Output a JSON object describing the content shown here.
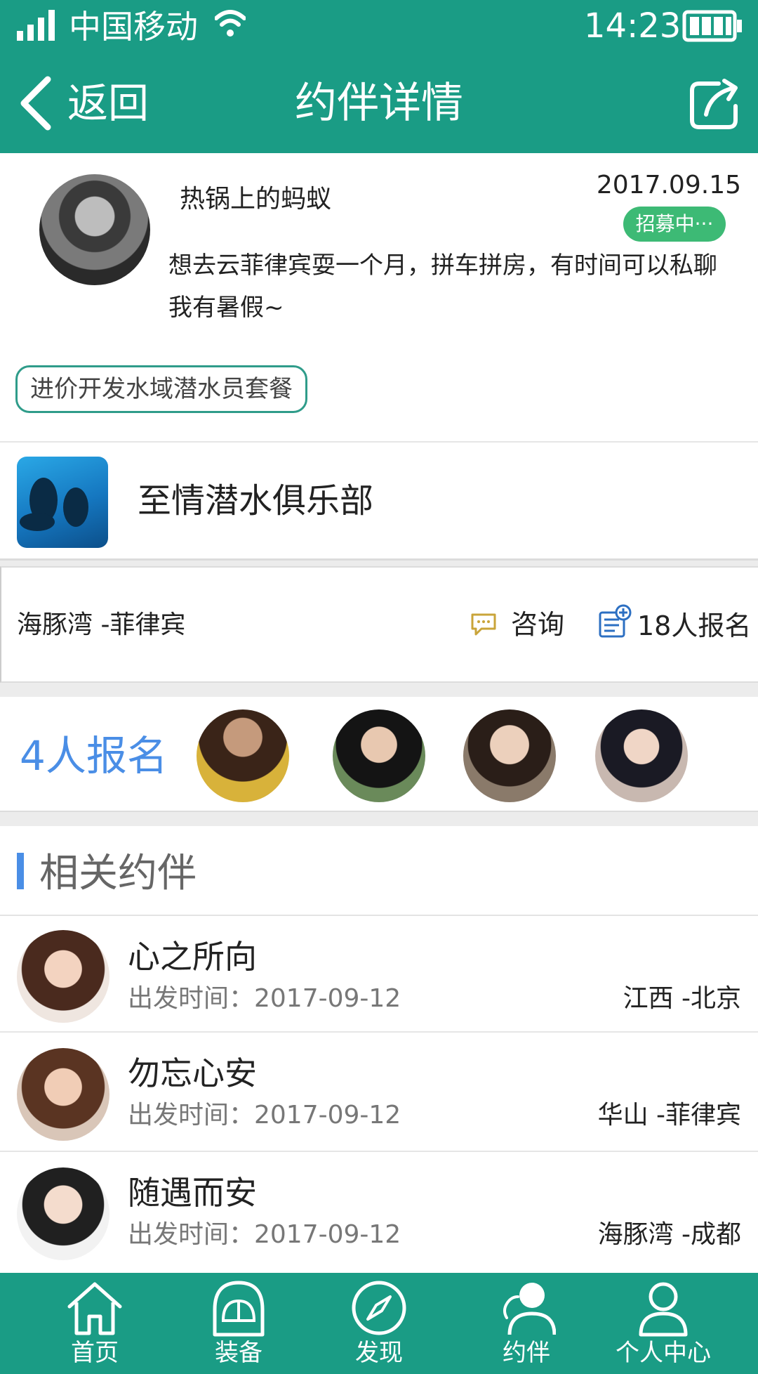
{
  "colors": {
    "primary": "#1a9c85",
    "badge": "#3dba75",
    "accent_blue": "#4a8ee6",
    "tag_border": "#2f9c8a"
  },
  "status_bar": {
    "carrier": "中国移动",
    "time": "14:23",
    "icons": [
      "signal-icon",
      "wifi-icon",
      "battery-icon"
    ]
  },
  "nav": {
    "back_label": "返回",
    "title": "约伴详情",
    "icons": [
      "back-chevron-icon",
      "share-icon"
    ]
  },
  "post": {
    "username": "热锅上的蚂蚁",
    "date": "2017.09.15",
    "status": "招募中···",
    "content": "想去云菲律宾耍一个月，拼车拼房，有时间可以私聊我有暑假~",
    "tag": "进价开发水域潜水员套餐"
  },
  "club": {
    "name": "至情潜水俱乐部"
  },
  "info": {
    "location": "海豚湾 -菲律宾",
    "consult_label": "咨询",
    "signup_count": "18人报名",
    "icons": [
      "chat-bubble-icon",
      "signup-list-icon"
    ]
  },
  "participants": {
    "count_label": "4人报名"
  },
  "related": {
    "heading": "相关约伴",
    "items": [
      {
        "name": "心之所向",
        "time": "出发时间：2017-09-12",
        "route": "江西 -北京"
      },
      {
        "name": "勿忘心安",
        "time": "出发时间：2017-09-12",
        "route": "华山 -菲律宾"
      },
      {
        "name": "随遇而安",
        "time": "出发时间：2017-09-12",
        "route": "海豚湾 -成都"
      }
    ]
  },
  "tabs": [
    {
      "label": "首页",
      "icon": "home-icon"
    },
    {
      "label": "装备",
      "icon": "equipment-icon"
    },
    {
      "label": "发现",
      "icon": "compass-icon"
    },
    {
      "label": "约伴",
      "icon": "companion-icon"
    },
    {
      "label": "个人中心",
      "icon": "user-icon"
    }
  ]
}
